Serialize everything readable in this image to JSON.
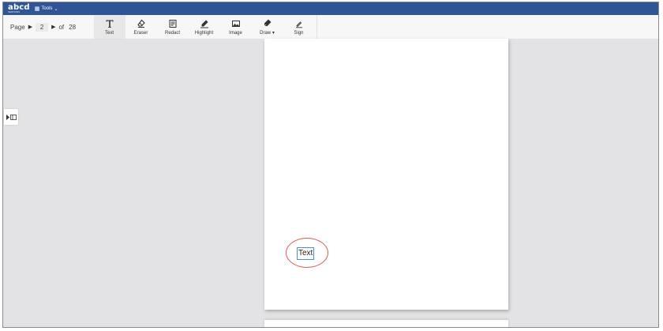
{
  "app": {
    "logo": "abcd",
    "logo_sub": "SERVICES",
    "menu_label": "Tools",
    "bar_color": "#2f5597"
  },
  "pager": {
    "label": "Page",
    "current": "2",
    "of_label": "of",
    "total": "28"
  },
  "tools": [
    {
      "label": "Text",
      "icon": "text-T-icon",
      "active": true
    },
    {
      "label": "Eraser",
      "icon": "eraser-icon"
    },
    {
      "label": "Redact",
      "icon": "redact-icon"
    },
    {
      "label": "Highlight",
      "icon": "highlighter-icon"
    },
    {
      "label": "Image",
      "icon": "image-icon"
    },
    {
      "label": "Draw",
      "icon": "pen-icon",
      "has_dropdown": true
    },
    {
      "label": "Sign",
      "icon": "signature-icon"
    }
  ],
  "document": {
    "text_annotation": "Text",
    "highlight_color": "#e05555"
  }
}
